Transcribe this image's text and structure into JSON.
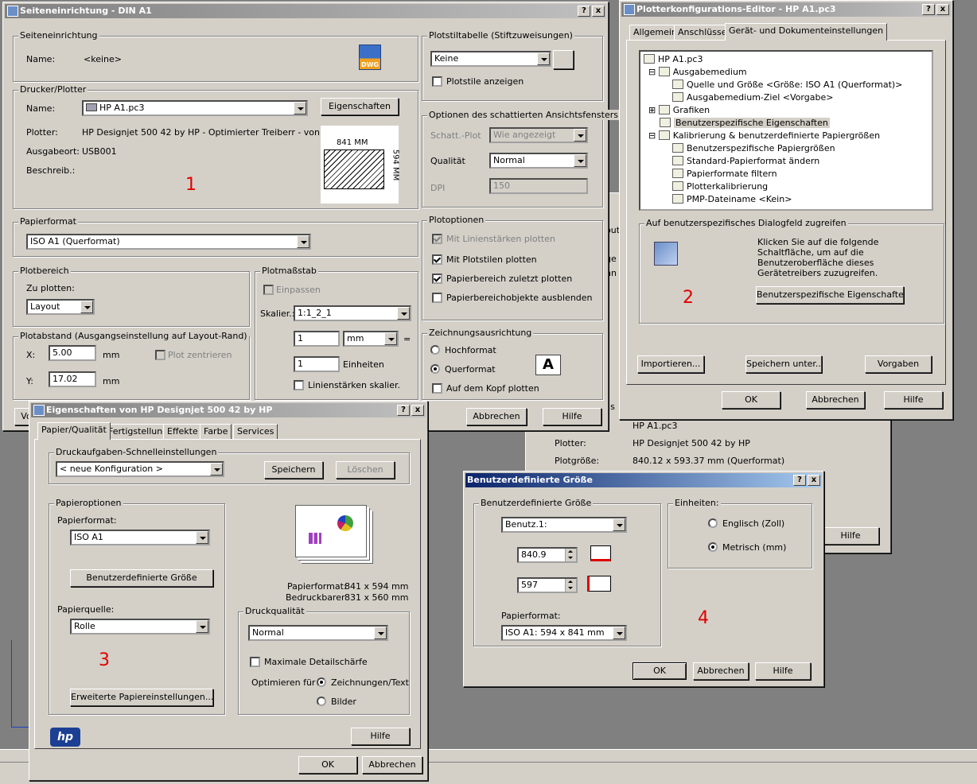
{
  "w1": {
    "title": "Seiteneinrichtung - DIN A1",
    "help_btn": "?",
    "close_btn": "x",
    "page_setup": {
      "group": "Seiteneinrichtung",
      "name_label": "Name:",
      "name_value": "<keine>",
      "dwg": "DWG"
    },
    "printer": {
      "group": "Drucker/Plotter",
      "name_label": "Name:",
      "name_value": "HP A1.pc3",
      "properties_btn": "Eigenschaften",
      "plotter_label": "Plotter:",
      "plotter_value": "HP Designjet 500 42 by HP - Optimierter Treiberr - von HP",
      "output_label": "Ausgabeort:",
      "output_value": "USB001",
      "desc_label": "Beschreib.:",
      "preview_w": "841 MM",
      "preview_h": "594 MM"
    },
    "marker": "1",
    "paper": {
      "group": "Papierformat",
      "value": "ISO A1  (Querformat)"
    },
    "area": {
      "group": "Plotbereich",
      "label": "Zu plotten:",
      "value": "Layout"
    },
    "offset": {
      "group": "Plotabstand (Ausgangseinstellung auf Layout-Rand)",
      "x_label": "X:",
      "x_value": "5.00",
      "x_unit": "mm",
      "center": "Plot zentrieren",
      "y_label": "Y:",
      "y_value": "17.02",
      "y_unit": "mm"
    },
    "scale": {
      "group": "Plotmaßstab",
      "fit": "Einpassen",
      "scale_label": "Skalier.:",
      "scale_value": "1:1_2_1",
      "v1": "1",
      "unit": "mm",
      "eq": "=",
      "v2": "1",
      "units_label": "Einheiten",
      "lw": "Linienstärken skalier."
    },
    "table": {
      "group": "Plotstiltabelle (Stiftzuweisungen)",
      "value": "Keine",
      "show": "Plotstile anzeigen"
    },
    "shade": {
      "group": "Optionen des schattierten Ansichtsfensters",
      "shade_label": "Schatt.-Plot",
      "shade_value": "Wie angezeigt",
      "quality_label": "Qualität",
      "quality_value": "Normal",
      "dpi_label": "DPI",
      "dpi_value": "150"
    },
    "plotopts": {
      "group": "Plotoptionen",
      "o1": "Mit Linienstärken plotten",
      "o2": "Mit Plotstilen plotten",
      "o3": "Papierbereich zuletzt plotten",
      "o4": "Papierbereichobjekte ausblenden"
    },
    "orient": {
      "group": "Zeichnungsausrichtung",
      "portrait": "Hochformat",
      "landscape": "Querformat",
      "upside": "Auf dem Kopf plotten",
      "glyph": "A"
    },
    "cancel_btn": "Abbrechen",
    "help_button": "Hilfe",
    "left_btn": "Vo"
  },
  "w2": {
    "title": "Plotterkonfigurations-Editor - HP A1.pc3",
    "help_btn": "?",
    "close_btn": "x",
    "tabs": [
      "Allgemein",
      "Anschlüsse",
      "Gerät- und Dokumenteinstellungen"
    ],
    "tree": [
      "HP A1.pc3",
      "Ausgabemedium",
      "Quelle und Größe <Größe: ISO A1  (Querformat)>",
      "Ausgabemedium-Ziel <Vorgabe>",
      "Grafiken",
      "Benutzerspezifische Eigenschaften",
      "Kalibrierung & benutzerdefinierte Papiergrößen",
      "Benutzerspezifische Papiergrößen",
      "Standard-Papierformat ändern",
      "Papierformate filtern",
      "Plotterkalibrierung",
      "PMP-Dateiname <Kein>"
    ],
    "custom_group": "Auf benutzerspezifisches Dialogfeld zugreifen",
    "custom_text": "Klicken Sie auf die folgende Schaltfläche, um auf die Benutzeroberfläche dieses Gerätetreibers zuzugreifen.",
    "custom_btn": "Benutzerspezifische Eigenschaften...",
    "marker": "2",
    "import_btn": "Importieren...",
    "saveas_btn": "Speichern unter...",
    "defaults_btn": "Vorgaben",
    "ok_btn": "OK",
    "cancel_btn": "Abbrechen",
    "help_button": "Hilfe"
  },
  "bg": {
    "frag1": "out",
    "frag2": "ge",
    "frag3": "nn",
    "frag4": "ils",
    "frag5": "ge",
    "name_value": "HP A1.pc3",
    "plotter_label": "Plotter:",
    "plotter_value": "HP Designjet 500 42 by HP",
    "size_label": "Plotgröße:",
    "size_value": "840.12 x 593.37 mm (Querformat)",
    "help_button": "Hilfe"
  },
  "w3": {
    "title": "Eigenschaften von HP Designjet 500 42 by HP",
    "help_btn": "?",
    "close_btn": "x",
    "tabs": [
      "Papier/Qualität",
      "Fertigstellung",
      "Effekte",
      "Farbe",
      "Services"
    ],
    "quick": {
      "group": "Druckaufgaben-Schnelleinstellungen",
      "value": "< neue Konfiguration >",
      "save_btn": "Speichern",
      "delete_btn": "Löschen"
    },
    "paper": {
      "group": "Papieroptionen",
      "format_label": "Papierformat:",
      "format_value": "ISO A1",
      "custom_btn": "Benutzerdefinierte Größe",
      "source_label": "Papierquelle:",
      "source_value": "Rolle",
      "advanced_btn": "Erweiterte Papiereinstellungen..."
    },
    "info": {
      "l1": "Papierformat:",
      "v1": "841  x  594 mm",
      "l2": "Bedruckbarer",
      "v2": "831  x  560 mm"
    },
    "quality": {
      "group": "Druckqualität",
      "value": "Normal",
      "detail": "Maximale Detailschärfe",
      "optimize": "Optimieren für",
      "r1": "Zeichnungen/Text",
      "r2": "Bilder"
    },
    "marker": "3",
    "logo": "hp",
    "help_button": "Hilfe",
    "ok_btn": "OK",
    "cancel_btn": "Abbrechen"
  },
  "w4": {
    "title": "Benutzerdefinierte Größe",
    "help_btn": "?",
    "close_btn": "x",
    "group": "Benutzerdefinierte Größe",
    "preset": "Benutz.1:",
    "width": "840.9",
    "height": "597",
    "format_label": "Papierformat:",
    "format_value": "ISO A1: 594 x 841 mm",
    "units_group": "Einheiten:",
    "english": "Englisch (Zoll)",
    "metric": "Metrisch (mm)",
    "marker": "4",
    "ok_btn": "OK",
    "cancel_btn": "Abbrechen",
    "help_button": "Hilfe"
  }
}
